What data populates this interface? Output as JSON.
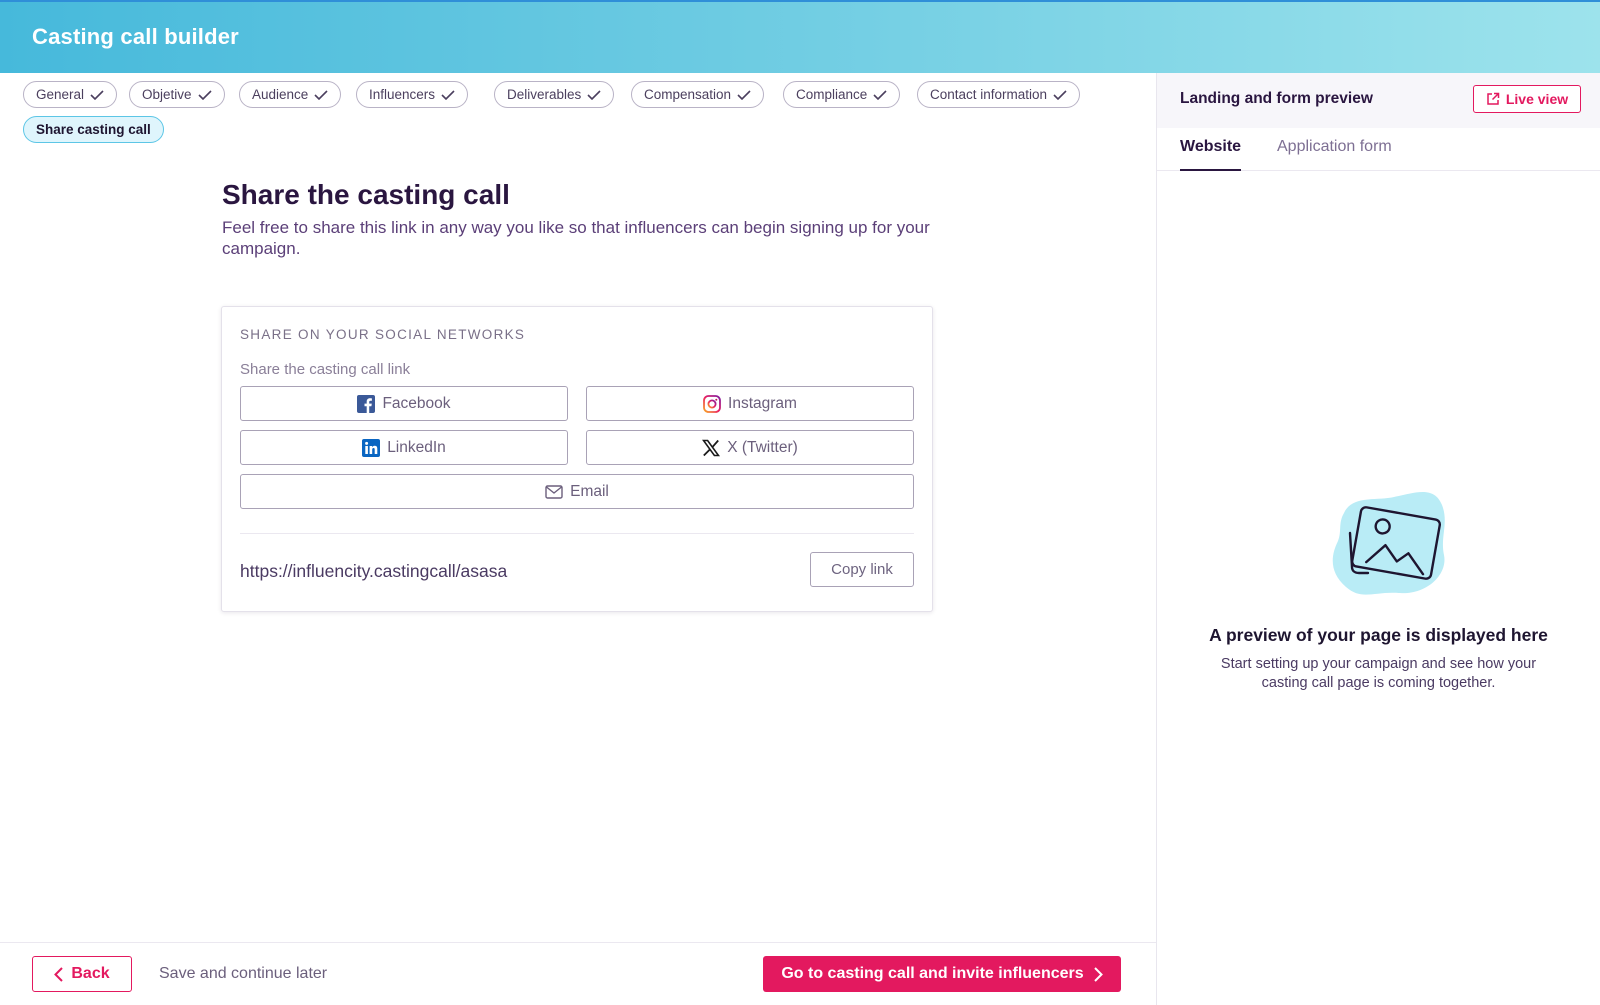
{
  "header": {
    "title": "Casting call builder"
  },
  "steps": [
    {
      "label": "General",
      "checked": true
    },
    {
      "label": "Objetive",
      "checked": true
    },
    {
      "label": "Audience",
      "checked": true
    },
    {
      "label": "Influencers",
      "checked": true
    },
    {
      "label": "Deliverables",
      "checked": true
    },
    {
      "label": "Compensation",
      "checked": true
    },
    {
      "label": "Compliance",
      "checked": true
    },
    {
      "label": "Contact information",
      "checked": true
    },
    {
      "label": "Share casting call",
      "checked": false,
      "active": true
    }
  ],
  "share": {
    "title": "Share the casting call",
    "description": "Feel free to share this link in any way you like so that influencers can begin signing up for your campaign.",
    "card_heading": "SHARE ON YOUR SOCIAL NETWORKS",
    "card_subtitle": "Share the casting call link",
    "buttons": {
      "facebook": "Facebook",
      "instagram": "Instagram",
      "linkedin": "LinkedIn",
      "twitter": "X (Twitter)",
      "email": "Email"
    },
    "link": "https://influencity.castingcall/asasa",
    "copy_label": "Copy link"
  },
  "footer": {
    "back_label": "Back",
    "save_later_label": "Save and continue later",
    "primary_label": "Go to casting call and invite influencers"
  },
  "preview": {
    "title": "Landing and form preview",
    "live_view_label": "Live view",
    "tabs": [
      "Website",
      "Application form"
    ],
    "active_tab": "Website",
    "empty_title": "A preview of your page is displayed here",
    "empty_description": "Start setting up your campaign and see how your casting call page is coming together."
  },
  "colors": {
    "accent": "#e3195f",
    "header_gradient_start": "#46b9db",
    "header_gradient_end": "#9de3ec",
    "text_primary": "#2a1640",
    "active_chip_bg": "#dff5fc"
  },
  "icons": [
    "check-icon",
    "facebook-icon",
    "instagram-icon",
    "linkedin-icon",
    "x-twitter-icon",
    "mail-icon",
    "chevron-left-icon",
    "chevron-right-icon",
    "external-link-icon",
    "image-placeholder-icon"
  ]
}
